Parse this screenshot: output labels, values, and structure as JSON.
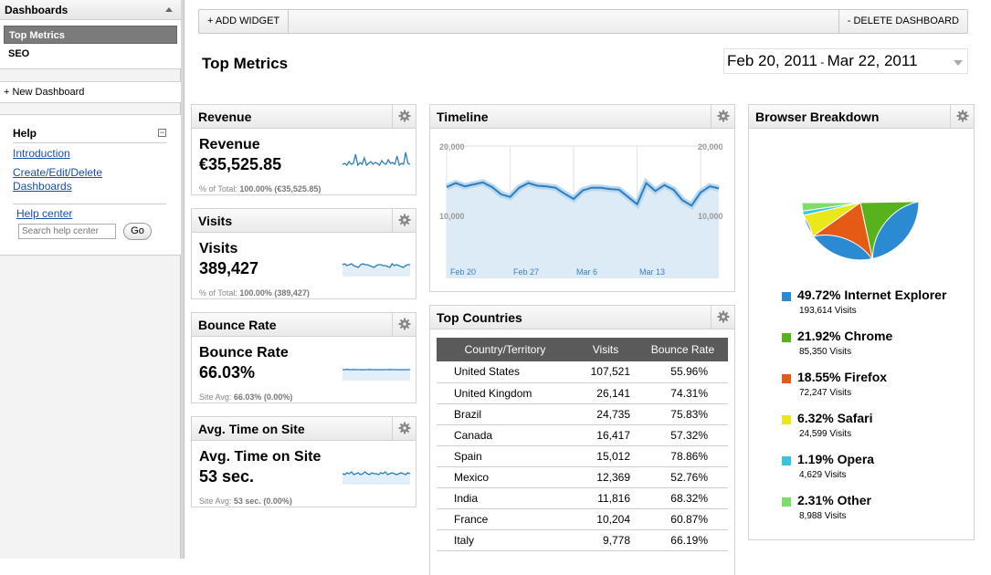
{
  "sidebar": {
    "header": "Dashboards",
    "items": [
      {
        "label": "Top Metrics",
        "active": true
      },
      {
        "label": "SEO",
        "active": false
      }
    ],
    "new_dashboard": "+ New Dashboard",
    "help": {
      "title": "Help",
      "collapse_symbol": "⊟",
      "links": [
        "Introduction",
        "Create/Edit/Delete Dashboards"
      ],
      "help_center": "Help center",
      "search_placeholder": "Search help center",
      "go_label": "Go"
    }
  },
  "toolbar": {
    "add_widget": "+ ADD WIDGET",
    "delete_dashboard": "- DELETE DASHBOARD"
  },
  "page": {
    "title": "Top Metrics",
    "date_start": "Feb 20, 2011",
    "date_sep": " - ",
    "date_end": "Mar 22, 2011"
  },
  "metrics": [
    {
      "header": "Revenue",
      "title": "Revenue",
      "value": "€35,525.85",
      "foot_prefix": "% of Total: ",
      "foot_bold": "100.00% (€35,525.85)",
      "foot_suffix": ""
    },
    {
      "header": "Visits",
      "title": "Visits",
      "value": "389,427",
      "foot_prefix": "% of Total: ",
      "foot_bold": "100.00% (389,427)",
      "foot_suffix": ""
    },
    {
      "header": "Bounce Rate",
      "title": "Bounce Rate",
      "value": "66.03%",
      "foot_prefix": "Site Avg: ",
      "foot_bold": "66.03% (0.00%)",
      "foot_suffix": ""
    },
    {
      "header": "Avg. Time on Site",
      "title": "Avg. Time on Site",
      "value": "53 sec.",
      "foot_prefix": "Site Avg: ",
      "foot_bold": "53 sec. (0.00%)",
      "foot_suffix": ""
    }
  ],
  "timeline": {
    "header": "Timeline",
    "y_ticks": [
      "20,000",
      "10,000"
    ],
    "x_ticks": [
      "Feb 20",
      "Feb 27",
      "Mar 6",
      "Mar 13"
    ],
    "colors": {
      "line": "#2b7ec0",
      "fill": "#dcebf6"
    },
    "chart_data": {
      "type": "area",
      "x": [
        "Feb 20",
        "Feb 21",
        "Feb 22",
        "Feb 23",
        "Feb 24",
        "Feb 25",
        "Feb 26",
        "Feb 27",
        "Feb 28",
        "Mar 1",
        "Mar 2",
        "Mar 3",
        "Mar 4",
        "Mar 5",
        "Mar 6",
        "Mar 7",
        "Mar 8",
        "Mar 9",
        "Mar 10",
        "Mar 11",
        "Mar 12",
        "Mar 13",
        "Mar 14",
        "Mar 15",
        "Mar 16",
        "Mar 17",
        "Mar 18",
        "Mar 19",
        "Mar 20",
        "Mar 21",
        "Mar 22"
      ],
      "series": [
        {
          "values": [
            13800,
            14400,
            13900,
            14200,
            14500,
            13800,
            12700,
            12300,
            13700,
            14400,
            14000,
            13900,
            13700,
            12800,
            12000,
            13300,
            13700,
            13700,
            13500,
            13400,
            12300,
            11200,
            14400,
            13200,
            14100,
            13400,
            11800,
            11000,
            13000,
            13900,
            13600
          ]
        }
      ],
      "ylim": [
        0,
        20000
      ]
    }
  },
  "countries": {
    "header": "Top Countries",
    "columns": [
      "Country/Territory",
      "Visits",
      "Bounce Rate"
    ],
    "rows": [
      [
        "United States",
        "107,521",
        "55.96%"
      ],
      [
        "United Kingdom",
        "26,141",
        "74.31%"
      ],
      [
        "Brazil",
        "24,735",
        "75.83%"
      ],
      [
        "Canada",
        "16,417",
        "57.32%"
      ],
      [
        "Spain",
        "15,012",
        "78.86%"
      ],
      [
        "Mexico",
        "12,369",
        "52.76%"
      ],
      [
        "India",
        "11,816",
        "68.32%"
      ],
      [
        "France",
        "10,204",
        "60.87%"
      ],
      [
        "Italy",
        "9,778",
        "66.19%"
      ]
    ]
  },
  "browsers": {
    "header": "Browser Breakdown",
    "chart_data": {
      "type": "pie",
      "slices": [
        {
          "label": "49.72% Internet Explorer",
          "value": 49.72,
          "visits": "193,614 Visits",
          "color": "#2a8ad2"
        },
        {
          "label": "21.92% Chrome",
          "value": 21.92,
          "visits": "85,350 Visits",
          "color": "#58b21c"
        },
        {
          "label": "18.55% Firefox",
          "value": 18.55,
          "visits": "72,247 Visits",
          "color": "#e55a14"
        },
        {
          "label": "6.32% Safari",
          "value": 6.32,
          "visits": "24,599 Visits",
          "color": "#e8e81a"
        },
        {
          "label": "1.19% Opera",
          "value": 1.19,
          "visits": "4,629 Visits",
          "color": "#3cc3e0"
        },
        {
          "label": "2.31% Other",
          "value": 2.31,
          "visits": "8,988 Visits",
          "color": "#7ddc6a"
        }
      ]
    }
  },
  "sparklines": {
    "color": "#2b7ec0",
    "revenue": [
      0.35,
      0.4,
      0.3,
      0.5,
      0.35,
      0.4,
      0.9,
      0.3,
      0.45,
      0.35,
      0.7,
      0.3,
      0.4,
      0.5,
      0.35,
      0.45,
      0.4,
      0.3,
      0.55,
      0.4,
      0.35,
      0.6,
      0.4,
      0.45,
      0.35,
      0.8,
      0.3,
      0.4,
      0.35,
      1.0,
      0.4,
      0.35
    ],
    "visits": [
      0.55,
      0.6,
      0.5,
      0.55,
      0.6,
      0.5,
      0.45,
      0.4,
      0.55,
      0.6,
      0.55,
      0.55,
      0.5,
      0.45,
      0.4,
      0.5,
      0.55,
      0.55,
      0.5,
      0.5,
      0.45,
      0.4,
      0.6,
      0.5,
      0.55,
      0.5,
      0.45,
      0.4,
      0.5,
      0.55,
      0.55
    ],
    "bounce": [
      0.5,
      0.5,
      0.52,
      0.5,
      0.5,
      0.51,
      0.5,
      0.5,
      0.5,
      0.49,
      0.5,
      0.5,
      0.51,
      0.5,
      0.5,
      0.5,
      0.5,
      0.49,
      0.5,
      0.5,
      0.5,
      0.51,
      0.5,
      0.5,
      0.5,
      0.5,
      0.49,
      0.5,
      0.5,
      0.5,
      0.5
    ],
    "time": [
      0.5,
      0.45,
      0.55,
      0.5,
      0.6,
      0.45,
      0.5,
      0.55,
      0.45,
      0.5,
      0.6,
      0.5,
      0.45,
      0.55,
      0.5,
      0.5,
      0.45,
      0.55,
      0.5,
      0.6,
      0.45,
      0.5,
      0.55,
      0.5,
      0.45,
      0.5,
      0.55,
      0.5,
      0.45,
      0.55,
      0.5
    ]
  }
}
